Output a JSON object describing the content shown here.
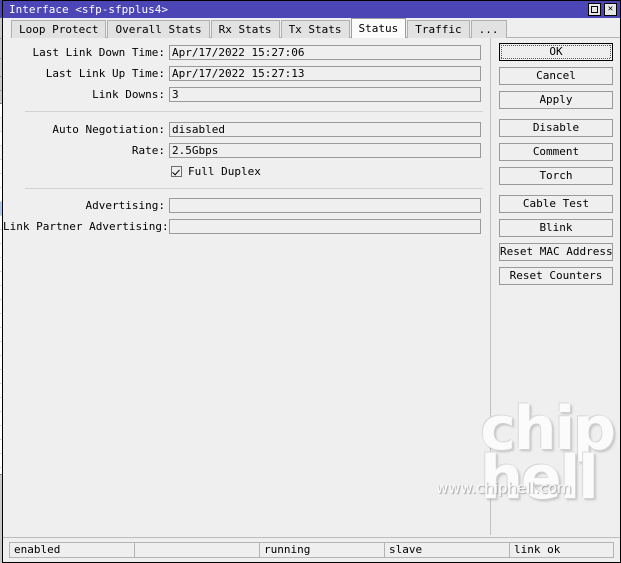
{
  "window": {
    "title": "Interface <sfp-sfpplus4>",
    "maximize_icon": "maximize-square-icon",
    "close_label": "✕",
    "title_color": "#4b45b5"
  },
  "tabs": [
    {
      "label": "Loop Protect",
      "active": false
    },
    {
      "label": "Overall Stats",
      "active": false
    },
    {
      "label": "Rx Stats",
      "active": false
    },
    {
      "label": "Tx Stats",
      "active": false
    },
    {
      "label": "Status",
      "active": true
    },
    {
      "label": "Traffic",
      "active": false
    },
    {
      "label": "...",
      "active": false
    }
  ],
  "form": {
    "fields": [
      {
        "label": "Last Link Down Time:",
        "value": "Apr/17/2022 15:27:06"
      },
      {
        "label": "Last Link Up Time:",
        "value": "Apr/17/2022 15:27:13"
      },
      {
        "label": "Link Downs:",
        "value": "3"
      },
      {
        "label": "Auto Negotiation:",
        "value": "disabled"
      },
      {
        "label": "Rate:",
        "value": "2.5Gbps"
      },
      {
        "label": "Advertising:",
        "value": ""
      },
      {
        "label": "Link Partner Advertising:",
        "value": ""
      }
    ],
    "full_duplex": {
      "label": "Full Duplex",
      "checked": true
    }
  },
  "buttons": [
    {
      "label": "OK",
      "primary": true
    },
    {
      "label": "Cancel",
      "primary": false
    },
    {
      "label": "Apply",
      "primary": false
    },
    {
      "label": "Disable",
      "primary": false
    },
    {
      "label": "Comment",
      "primary": false
    },
    {
      "label": "Torch",
      "primary": false
    },
    {
      "label": "Cable Test",
      "primary": false
    },
    {
      "label": "Blink",
      "primary": false
    },
    {
      "label": "Reset MAC Address",
      "primary": false
    },
    {
      "label": "Reset Counters",
      "primary": false
    }
  ],
  "statusbar": {
    "cells": [
      "enabled",
      "",
      "running",
      "slave",
      "link ok"
    ]
  },
  "watermark": {
    "logo_line1": "chip",
    "logo_line2": "hell",
    "url": "www.chiphell.com"
  }
}
